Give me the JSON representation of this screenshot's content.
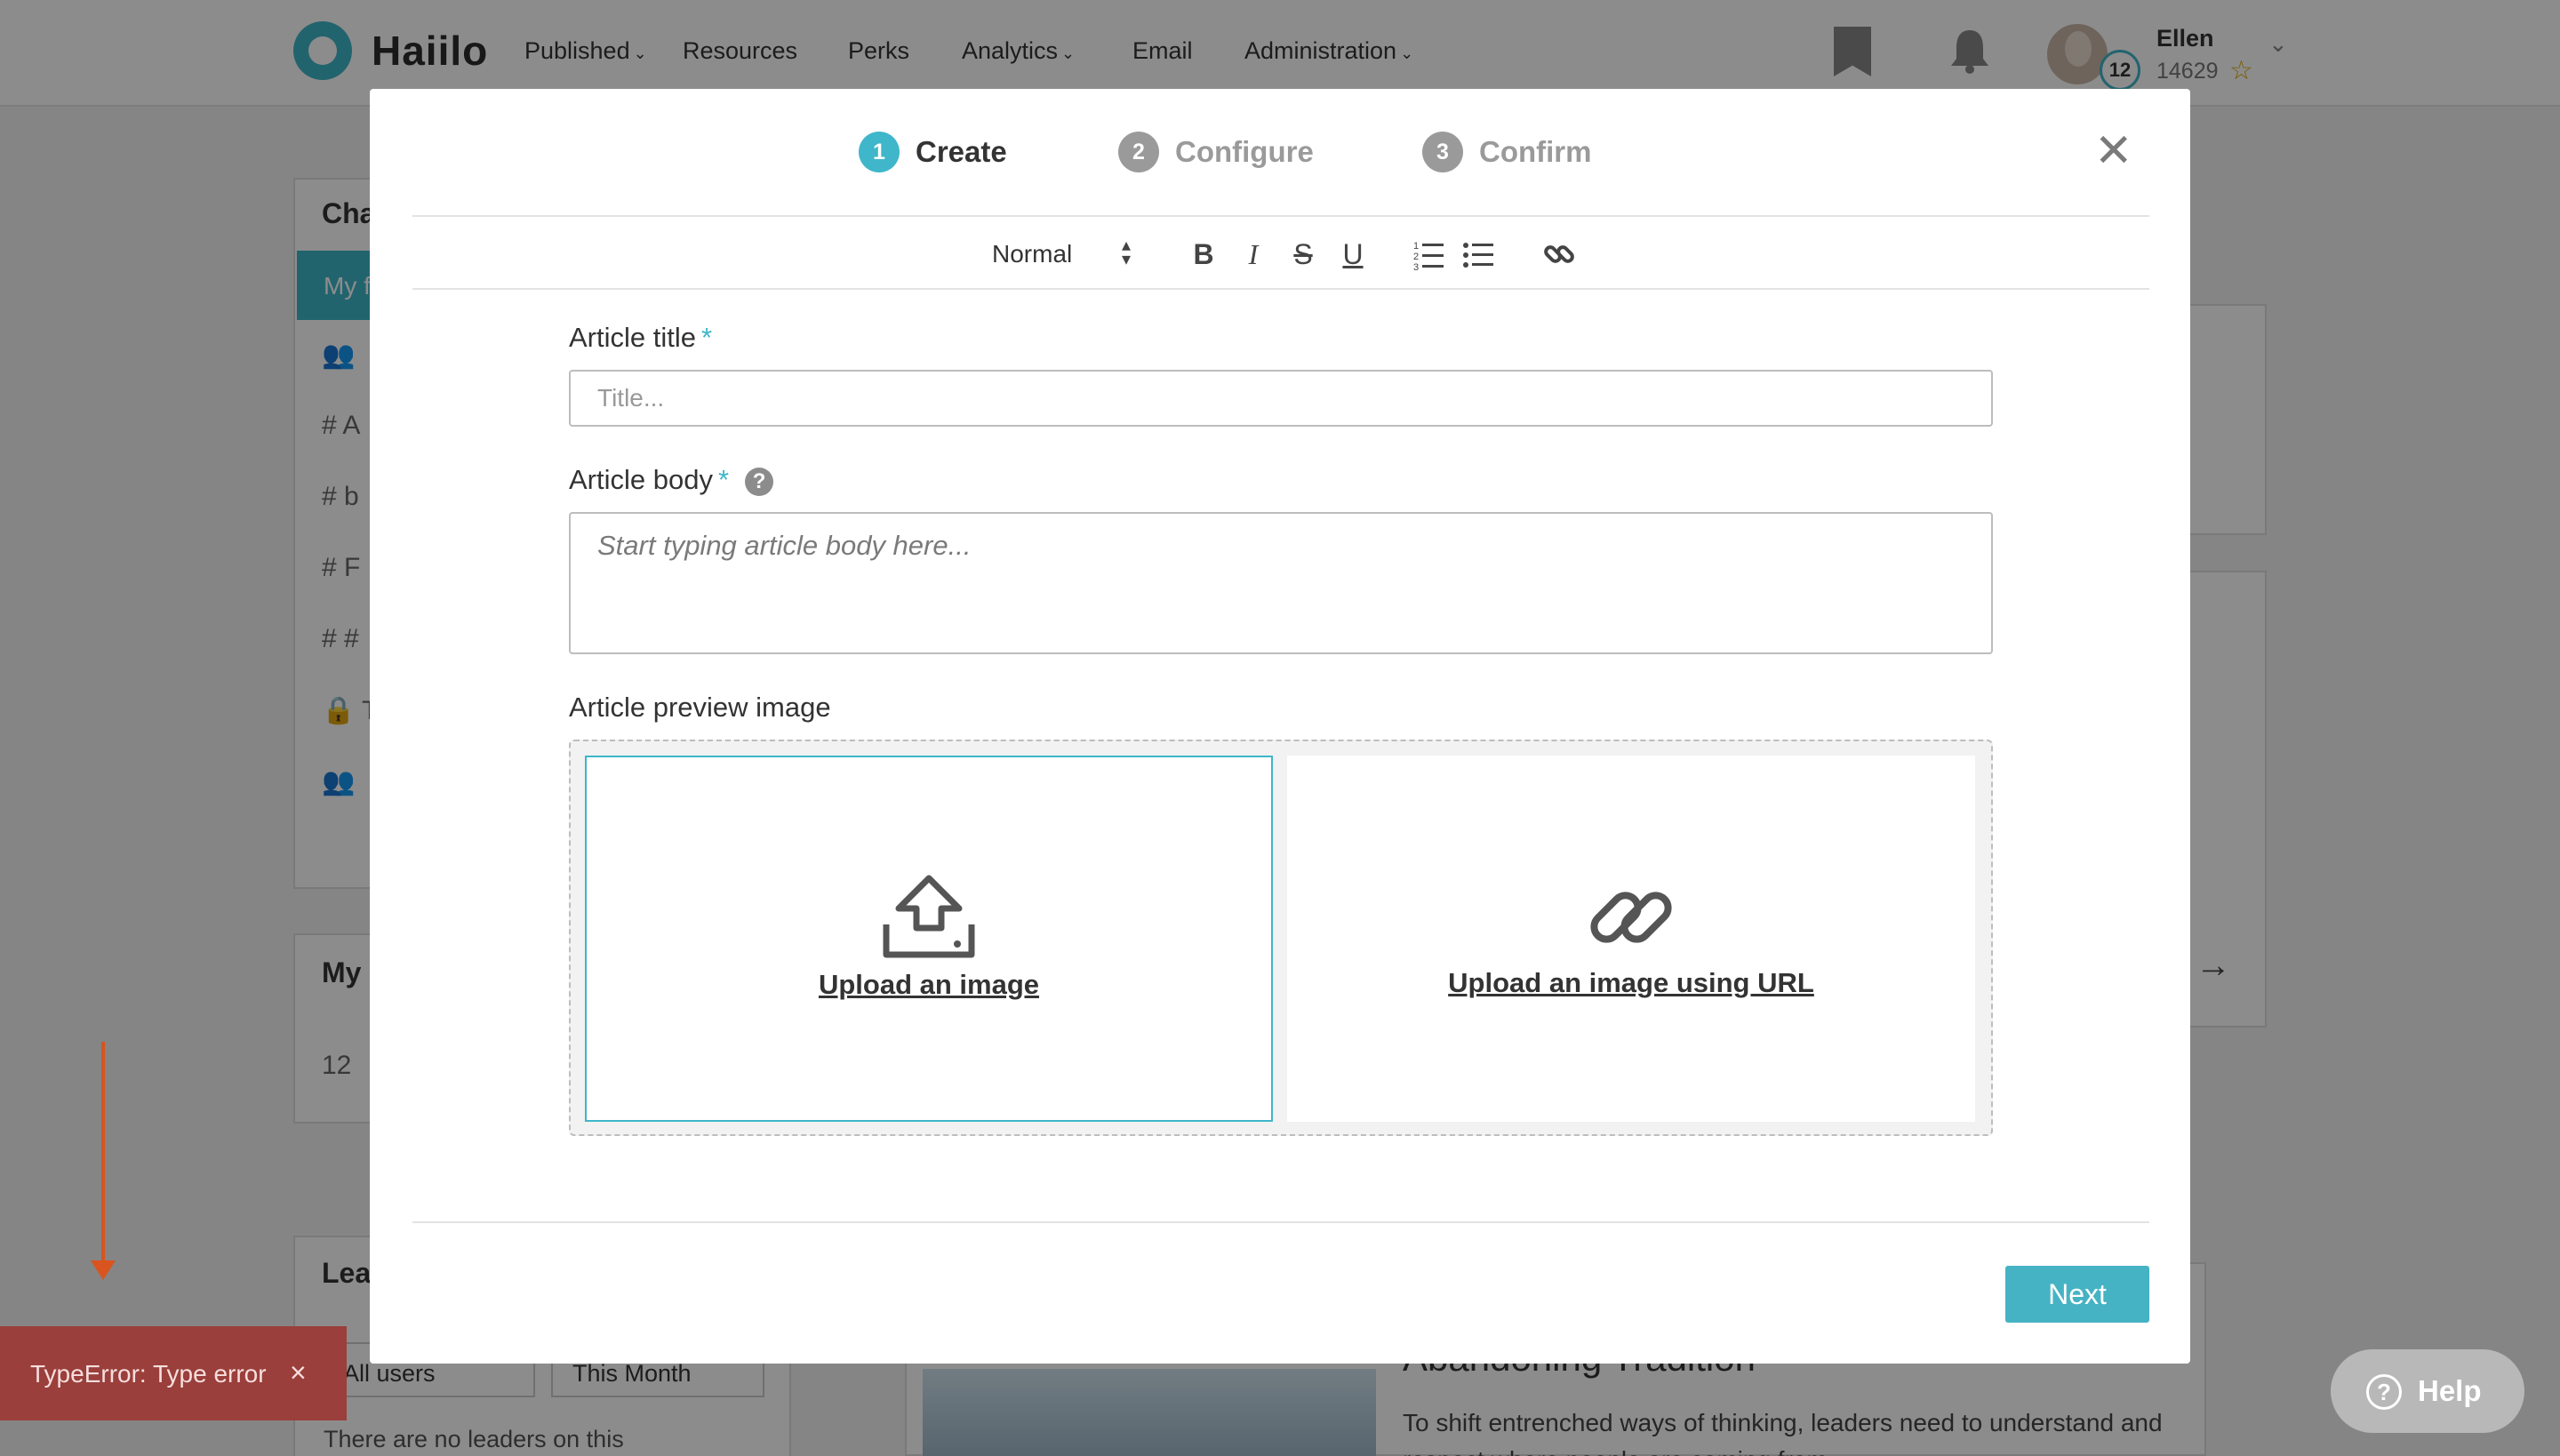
{
  "app": {
    "logo_text": "Haiilo",
    "nav": [
      {
        "label": "Published",
        "has_menu": true
      },
      {
        "label": "Resources",
        "has_menu": false
      },
      {
        "label": "Perks",
        "has_menu": false
      },
      {
        "label": "Analytics",
        "has_menu": true
      },
      {
        "label": "Email",
        "has_menu": false
      },
      {
        "label": "Administration",
        "has_menu": true
      }
    ],
    "user": {
      "name": "Ellen",
      "points": "14629",
      "level": "12"
    },
    "icons": {
      "bookmark": "bookmark-icon",
      "bell": "bell-icon",
      "star": "star-icon"
    }
  },
  "background": {
    "channels_head": "Cha",
    "active_item": "My f",
    "channel_rows": [
      "A",
      "b",
      "F",
      "#",
      "T"
    ],
    "my_head": "My",
    "my_value": "12",
    "leaders_head": "Lea",
    "leaders_filter_users": "All users",
    "leaders_filter_period": "This Month",
    "no_leaders": "There are no leaders on this",
    "article_title": "Abandoning Tradition",
    "article_text": "To shift entrenched ways of thinking, leaders need to understand and respect where people are coming from."
  },
  "modal": {
    "steps": [
      {
        "num": "1",
        "label": "Create",
        "state": "active"
      },
      {
        "num": "2",
        "label": "Configure",
        "state": "inactive"
      },
      {
        "num": "3",
        "label": "Confirm",
        "state": "inactive"
      }
    ],
    "close_icon": "close-icon",
    "toolbar": {
      "format_select": "Normal",
      "bold": "B",
      "italic": "I",
      "strike": "S",
      "underline": "U"
    },
    "article_title_label": "Article title",
    "article_title_placeholder": "Title...",
    "article_title_value": "",
    "article_body_label": "Article body",
    "article_body_placeholder": "Start typing article body here...",
    "article_body_value": "",
    "required_mark": "*",
    "help_mark": "?",
    "preview_label": "Article preview image",
    "upload_image": "Upload an image",
    "upload_url": "Upload an image using URL",
    "next": "Next"
  },
  "error": {
    "message": "TypeError: Type error",
    "close": "×"
  },
  "help_button": {
    "label": "Help",
    "icon": "?"
  },
  "colors": {
    "accent": "#3fb6c9",
    "error": "#9a3f3b",
    "annotation_arrow": "#d9541e"
  }
}
